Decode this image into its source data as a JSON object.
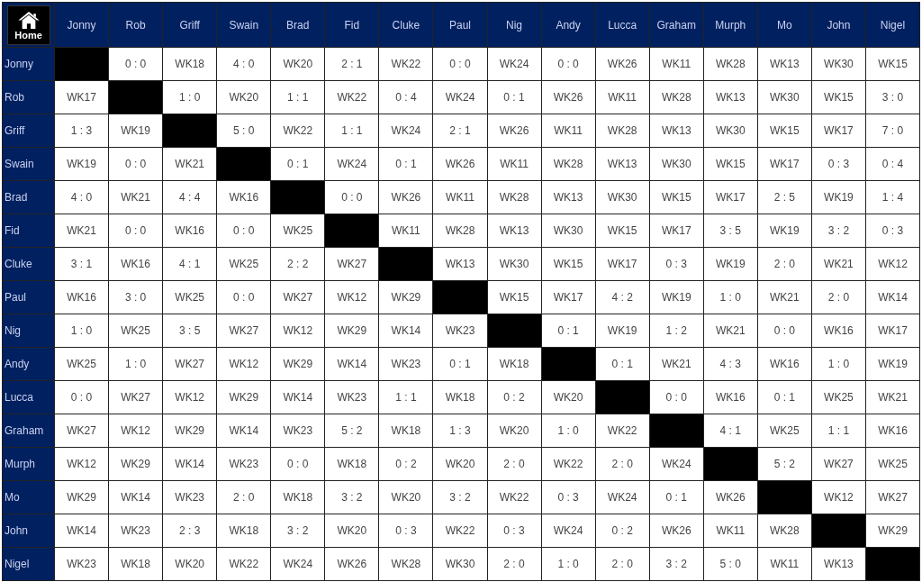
{
  "home_button": {
    "label": "Home"
  },
  "players": [
    "Jonny",
    "Rob",
    "Griff",
    "Swain",
    "Brad",
    "Fid",
    "Cluke",
    "Paul",
    "Nig",
    "Andy",
    "Lucca",
    "Graham",
    "Murph",
    "Mo",
    "John",
    "Nigel"
  ],
  "rows": [
    {
      "player": "Jonny",
      "cells": [
        null,
        "0 : 0",
        "WK18",
        "4 : 0",
        "WK20",
        "2 : 1",
        "WK22",
        "0 : 0",
        "WK24",
        "0 : 0",
        "WK26",
        "WK11",
        "WK28",
        "WK13",
        "WK30",
        "WK15"
      ]
    },
    {
      "player": "Rob",
      "cells": [
        "WK17",
        null,
        "1 : 0",
        "WK20",
        "1 : 1",
        "WK22",
        "0 : 4",
        "WK24",
        "0 : 1",
        "WK26",
        "WK11",
        "WK28",
        "WK13",
        "WK30",
        "WK15",
        "3 : 0"
      ]
    },
    {
      "player": "Griff",
      "cells": [
        "1 : 3",
        "WK19",
        null,
        "5 : 0",
        "WK22",
        "1 : 1",
        "WK24",
        "2 : 1",
        "WK26",
        "WK11",
        "WK28",
        "WK13",
        "WK30",
        "WK15",
        "WK17",
        "7 : 0"
      ]
    },
    {
      "player": "Swain",
      "cells": [
        "WK19",
        "0 : 0",
        "WK21",
        null,
        "0 : 1",
        "WK24",
        "0 : 1",
        "WK26",
        "WK11",
        "WK28",
        "WK13",
        "WK30",
        "WK15",
        "WK17",
        "0 : 3",
        "0 : 4"
      ]
    },
    {
      "player": "Brad",
      "cells": [
        "4 : 0",
        "WK21",
        "4 : 4",
        "WK16",
        null,
        "0 : 0",
        "WK26",
        "WK11",
        "WK28",
        "WK13",
        "WK30",
        "WK15",
        "WK17",
        "2 : 5",
        "WK19",
        "1 : 4"
      ]
    },
    {
      "player": "Fid",
      "cells": [
        "WK21",
        "0 : 0",
        "WK16",
        "0 : 0",
        "WK25",
        null,
        "WK11",
        "WK28",
        "WK13",
        "WK30",
        "WK15",
        "WK17",
        "3 : 5",
        "WK19",
        "3 : 2",
        "0 : 3"
      ]
    },
    {
      "player": "Cluke",
      "cells": [
        "3 : 1",
        "WK16",
        "4 : 1",
        "WK25",
        "2 : 2",
        "WK27",
        null,
        "WK13",
        "WK30",
        "WK15",
        "WK17",
        "0 : 3",
        "WK19",
        "2 : 0",
        "WK21",
        "WK12"
      ]
    },
    {
      "player": "Paul",
      "cells": [
        "WK16",
        "3 : 0",
        "WK25",
        "0 : 0",
        "WK27",
        "WK12",
        "WK29",
        null,
        "WK15",
        "WK17",
        "4 : 2",
        "WK19",
        "1 : 0",
        "WK21",
        "2 : 0",
        "WK14"
      ]
    },
    {
      "player": "Nig",
      "cells": [
        "1 : 0",
        "WK25",
        "3 : 5",
        "WK27",
        "WK12",
        "WK29",
        "WK14",
        "WK23",
        null,
        "0 : 1",
        "WK19",
        "1 : 2",
        "WK21",
        "0 : 0",
        "WK16",
        "WK17"
      ]
    },
    {
      "player": "Andy",
      "cells": [
        "WK25",
        "1 : 0",
        "WK27",
        "WK12",
        "WK29",
        "WK14",
        "WK23",
        "0 : 1",
        "WK18",
        null,
        "0 : 1",
        "WK21",
        "4 : 3",
        "WK16",
        "1 : 0",
        "WK19"
      ]
    },
    {
      "player": "Lucca",
      "cells": [
        "0 : 0",
        "WK27",
        "WK12",
        "WK29",
        "WK14",
        "WK23",
        "1 : 1",
        "WK18",
        "0 : 2",
        "WK20",
        null,
        "0 : 0",
        "WK16",
        "0 : 1",
        "WK25",
        "WK21"
      ]
    },
    {
      "player": "Graham",
      "cells": [
        "WK27",
        "WK12",
        "WK29",
        "WK14",
        "WK23",
        "5 : 2",
        "WK18",
        "1 : 3",
        "WK20",
        "1 : 0",
        "WK22",
        null,
        "4 : 1",
        "WK25",
        "1 : 1",
        "WK16"
      ]
    },
    {
      "player": "Murph",
      "cells": [
        "WK12",
        "WK29",
        "WK14",
        "WK23",
        "0 : 0",
        "WK18",
        "0 : 2",
        "WK20",
        "2 : 0",
        "WK22",
        "2 : 0",
        "WK24",
        null,
        "5 : 2",
        "WK27",
        "WK25"
      ]
    },
    {
      "player": "Mo",
      "cells": [
        "WK29",
        "WK14",
        "WK23",
        "2 : 0",
        "WK18",
        "3 : 2",
        "WK20",
        "3 : 2",
        "WK22",
        "0 : 3",
        "WK24",
        "0 : 1",
        "WK26",
        null,
        "WK12",
        "WK27"
      ]
    },
    {
      "player": "John",
      "cells": [
        "WK14",
        "WK23",
        "2 : 3",
        "WK18",
        "3 : 2",
        "WK20",
        "0 : 3",
        "WK22",
        "0 : 3",
        "WK24",
        "0 : 2",
        "WK26",
        "WK11",
        "WK28",
        null,
        "WK29"
      ]
    },
    {
      "player": "Nigel",
      "cells": [
        "WK23",
        "WK18",
        "WK20",
        "WK22",
        "WK24",
        "WK26",
        "WK28",
        "WK30",
        "2 : 0",
        "1 : 0",
        "2 : 0",
        "3 : 2",
        "5 : 0",
        "WK11",
        "WK13",
        null
      ]
    }
  ]
}
